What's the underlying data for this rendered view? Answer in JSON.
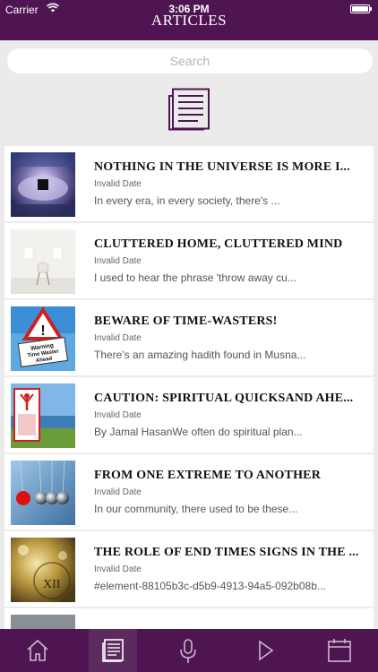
{
  "status_bar": {
    "carrier": "Carrier",
    "time": "3:06 PM",
    "battery_level": 1.0
  },
  "header": {
    "title": "ARTICLES"
  },
  "search": {
    "placeholder": "Search"
  },
  "hero": {
    "icon": "articles-document-icon"
  },
  "articles": [
    {
      "title": "NOTHING IN THE UNIVERSE IS MORE I...",
      "date": "Invalid Date",
      "excerpt": "In every era, in every society, there's ...",
      "thumb": "kaaba-crowd-image"
    },
    {
      "title": "CLUTTERED HOME, CLUTTERED MIND",
      "date": "Invalid Date",
      "excerpt": "I used to hear the phrase 'throw away cu...",
      "thumb": "minimal-room-chair-image"
    },
    {
      "title": "BEWARE OF TIME-WASTERS!",
      "date": "Invalid Date",
      "excerpt": "There's an amazing hadith found in Musna...",
      "thumb": "warning-sign-image",
      "thumb_text": "Warning Time Waster Ahead"
    },
    {
      "title": "CAUTION: SPIRITUAL QUICKSAND AHE...",
      "date": "Invalid Date",
      "excerpt": "By Jamal HasanWe often do spiritual plan...",
      "thumb": "quicksand-sign-image"
    },
    {
      "title": "FROM ONE EXTREME TO ANOTHER",
      "date": "Invalid Date",
      "excerpt": "In our community, there used to be these...",
      "thumb": "newtons-cradle-image"
    },
    {
      "title": "THE ROLE OF END TIMES SIGNS IN THE ...",
      "date": "Invalid Date",
      "excerpt": "#element-88105b3c-d5b9-4913-94a5-092b08b...",
      "thumb": "golden-clock-image"
    }
  ],
  "tabbar": {
    "tabs": [
      {
        "icon": "home-icon",
        "active": false
      },
      {
        "icon": "articles-icon",
        "active": true
      },
      {
        "icon": "microphone-icon",
        "active": false
      },
      {
        "icon": "play-icon",
        "active": false
      },
      {
        "icon": "calendar-icon",
        "active": false
      }
    ]
  },
  "colors": {
    "brand": "#4f1553",
    "background": "#ebebeb",
    "card": "#ffffff"
  }
}
